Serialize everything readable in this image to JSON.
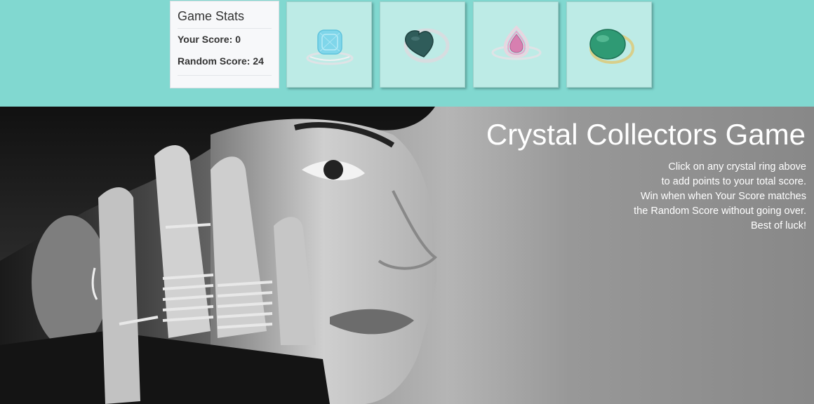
{
  "stats": {
    "title": "Game Stats",
    "your_score": "Your Score: 0",
    "random_score": "Random Score: 24"
  },
  "rings": [
    {
      "name": "Blue Topaz Crystal Ring",
      "stone_color": "#7fd6ea",
      "band_color": "#d9dde0"
    },
    {
      "name": "Dark Heart Crystal Ring",
      "stone_color": "#2f5c5a",
      "band_color": "#cfd6d8"
    },
    {
      "name": "Pink Pear Crystal Ring",
      "stone_color": "#d77fb0",
      "band_color": "#d9dde0"
    },
    {
      "name": "Green Cabochon Crystal Ring",
      "stone_color": "#2f9a74",
      "band_color": "#d8cf8a"
    }
  ],
  "hero": {
    "title": "Crystal Collectors Game",
    "lines": [
      "Click on any crystal ring above",
      "to add points to your total score.",
      "Win when when Your Score matches",
      "the Random Score without going over.",
      "Best of luck!"
    ]
  },
  "colors": {
    "accent": "#81d8d0",
    "card": "#bdebe6",
    "text_light": "#ffffff"
  }
}
